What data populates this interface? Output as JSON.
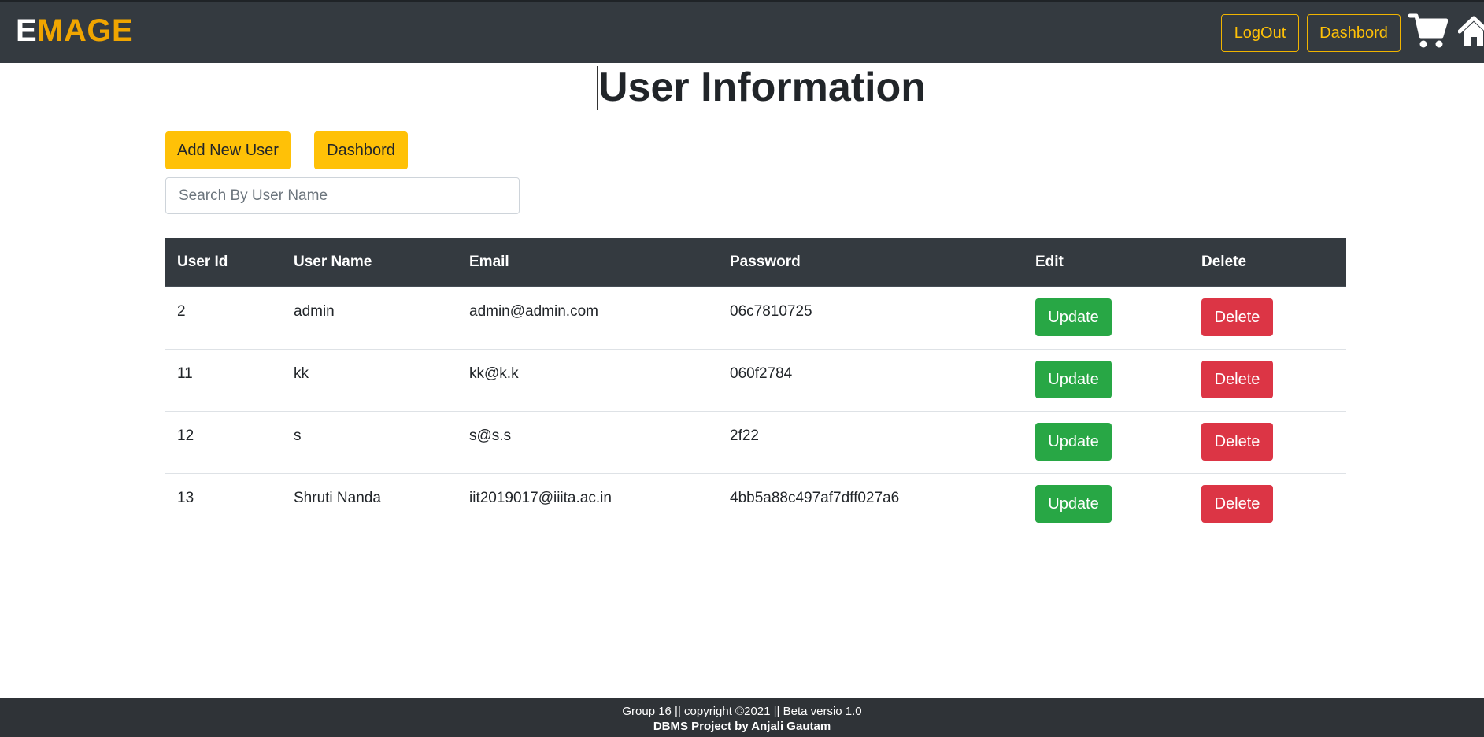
{
  "navbar": {
    "brand_first": "E",
    "brand_rest": "MAGE",
    "logout_label": "LogOut",
    "dashboard_label": "Dashbord",
    "cart_icon": "cart-icon",
    "home_icon": "home-icon"
  },
  "main": {
    "title": "User Information",
    "add_user_label": "Add New User",
    "dashboard_label": "Dashbord",
    "search_placeholder": "Search By User Name"
  },
  "table": {
    "headers": [
      "User Id",
      "User Name",
      "Email",
      "Password",
      "Edit",
      "Delete"
    ],
    "rows": [
      {
        "id": "2",
        "name": "admin",
        "email": "admin@admin.com",
        "password": "06c7810725",
        "update": "Update",
        "delete": "Delete"
      },
      {
        "id": "11",
        "name": "kk",
        "email": "kk@k.k",
        "password": "060f2784",
        "update": "Update",
        "delete": "Delete"
      },
      {
        "id": "12",
        "name": "s",
        "email": "s@s.s",
        "password": "2f22",
        "update": "Update",
        "delete": "Delete"
      },
      {
        "id": "13",
        "name": "Shruti Nanda",
        "email": "iit2019017@iiita.ac.in",
        "password": "4bb5a88c497af7dff027a6",
        "update": "Update",
        "delete": "Delete"
      }
    ]
  },
  "footer": {
    "line1": "Group 16 || copyright ©2021 || Beta versio 1.0",
    "line2": "DBMS Project by Anjali Gautam"
  },
  "colors": {
    "navbar_bg": "#343a40",
    "brand_accent": "#f0a500",
    "warning": "#ffc107",
    "success": "#28a745",
    "danger": "#dc3545"
  }
}
